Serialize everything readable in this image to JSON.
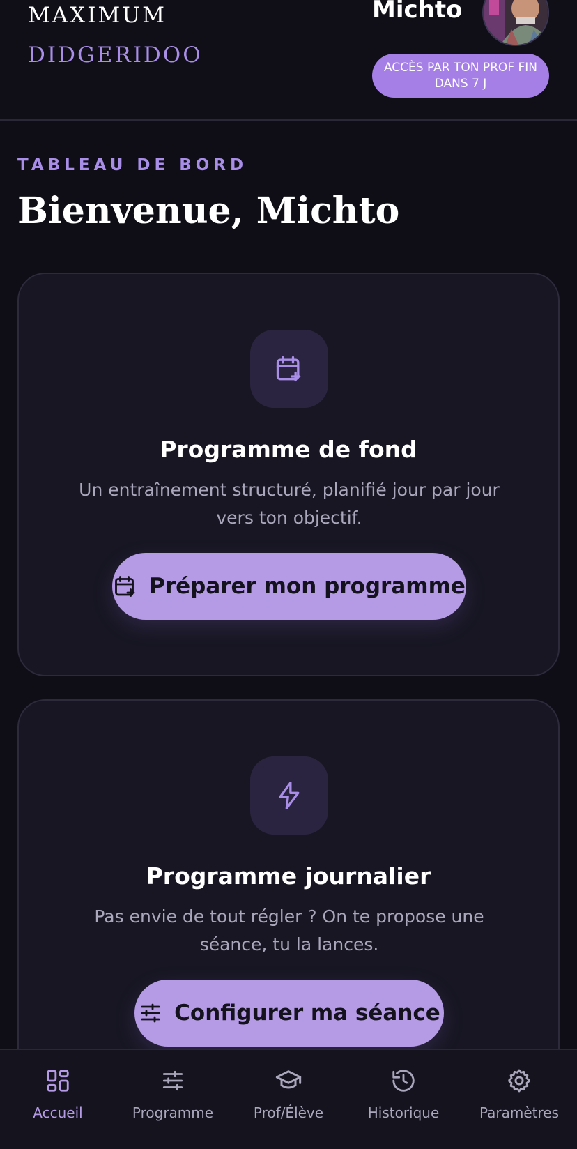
{
  "header": {
    "brand_line1": "MAXIMUM",
    "brand_line2": "DIDGERIDOO",
    "user_name": "Michto",
    "access_badge": "ACCÈS PAR TON PROF FIN DANS 7 J"
  },
  "main": {
    "eyebrow": "TABLEAU DE BORD",
    "title": "Bienvenue, Michto",
    "cards": [
      {
        "icon": "calendar-plus-icon",
        "title": "Programme de fond",
        "description": "Un entraînement structuré, planifié jour par jour vers ton objectif.",
        "button_icon": "calendar-plus-icon",
        "button_label": "Préparer mon programme"
      },
      {
        "icon": "lightning-icon",
        "title": "Programme journalier",
        "description": "Pas envie de tout régler ? On te propose une séance, tu la lances.",
        "button_icon": "sliders-icon",
        "button_label": "Configurer ma séance"
      }
    ]
  },
  "bottom_nav": {
    "items": [
      {
        "label": "Accueil",
        "icon": "dashboard-icon",
        "active": true
      },
      {
        "label": "Programme",
        "icon": "sliders-icon",
        "active": false
      },
      {
        "label": "Prof/Élève",
        "icon": "graduation-cap-icon",
        "active": false
      },
      {
        "label": "Historique",
        "icon": "history-icon",
        "active": false
      },
      {
        "label": "Paramètres",
        "icon": "gear-icon",
        "active": false
      }
    ]
  },
  "colors": {
    "background": "#0f0e17",
    "accent": "#a57fe6",
    "button": "#b59ae6",
    "card": "#171622",
    "muted_text": "#aaa6bc"
  }
}
